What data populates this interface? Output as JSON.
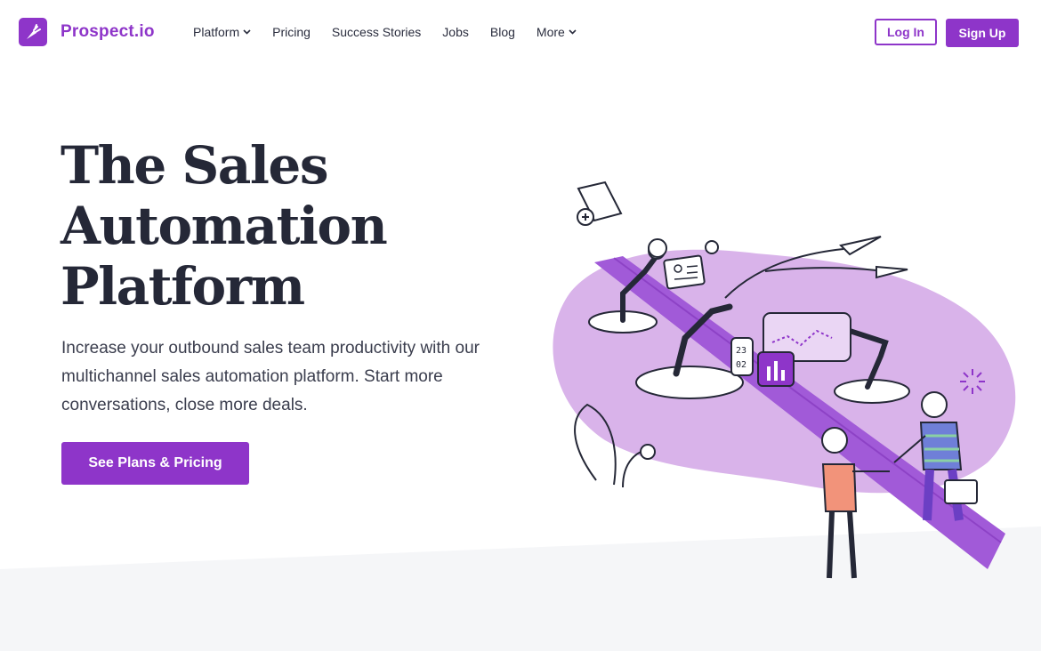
{
  "brand": {
    "name": "Prospect.io",
    "accent_color": "#8e35c9",
    "logo_icon": "carrot-rocket-icon"
  },
  "nav": {
    "items": [
      {
        "label": "Platform",
        "has_dropdown": true
      },
      {
        "label": "Pricing",
        "has_dropdown": false
      },
      {
        "label": "Success Stories",
        "has_dropdown": false
      },
      {
        "label": "Jobs",
        "has_dropdown": false
      },
      {
        "label": "Blog",
        "has_dropdown": false
      },
      {
        "label": "More",
        "has_dropdown": true
      }
    ],
    "dropdown_icon": "chevron-down-icon"
  },
  "auth": {
    "login_label": "Log In",
    "signup_label": "Sign Up"
  },
  "hero": {
    "title_lines": [
      "The Sales",
      "Automation",
      "Platform"
    ],
    "subtitle": "Increase your outbound sales team productivity with our multichannel sales automation platform. Start more conversations, close more deals.",
    "cta_label": "See Plans & Pricing"
  },
  "illustration": {
    "calendar_text_top": "23",
    "calendar_text_bottom": "02",
    "description_icon": "sales-automation-illustration"
  },
  "colors": {
    "heading": "#252837",
    "body_text": "#3a3d4d",
    "illustration_light": "#d9b3ea",
    "illustration_mid": "#b77de0",
    "illustration_dark": "#8e35c9",
    "footer_band": "#f5f6f8"
  }
}
